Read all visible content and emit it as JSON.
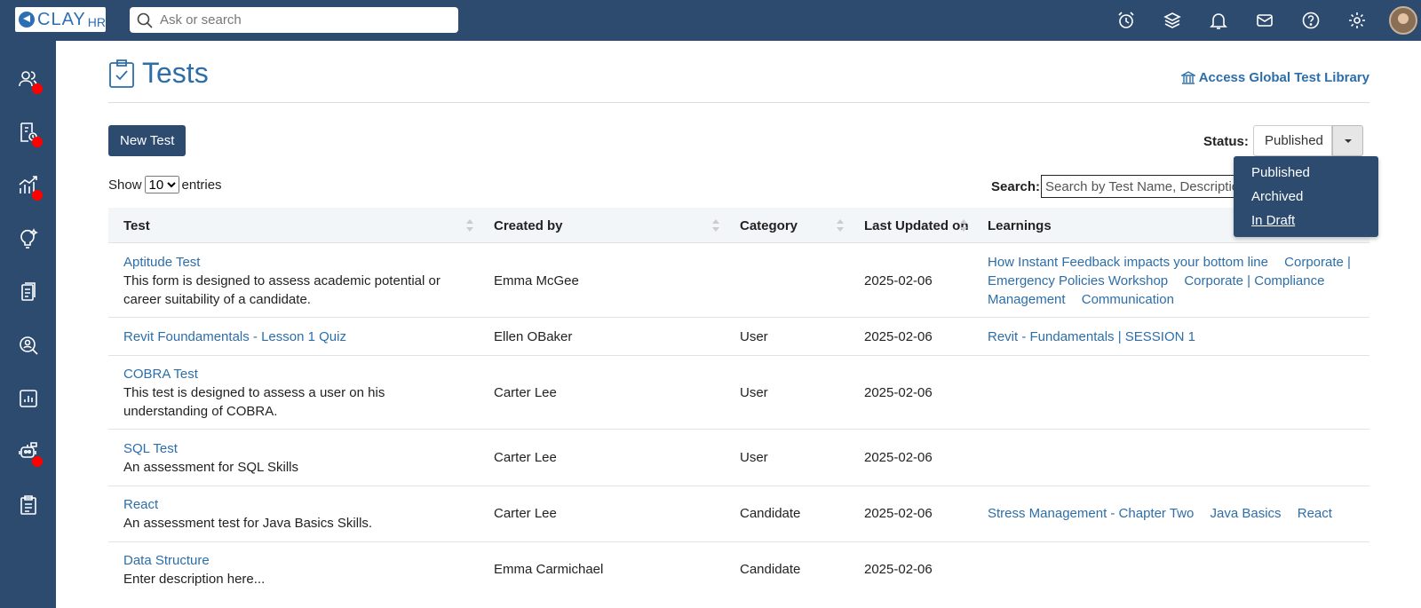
{
  "app": {
    "logo_text": "CLAY",
    "logo_sub": "HR"
  },
  "topbar": {
    "search_placeholder": "Ask or search",
    "icons": [
      "alarm-clock-icon",
      "layers-icon",
      "bell-icon",
      "mail-icon",
      "help-icon",
      "gear-icon"
    ]
  },
  "sidebar": {
    "items": [
      {
        "icon": "people-icon",
        "badge": true
      },
      {
        "icon": "payroll-icon",
        "badge": true
      },
      {
        "icon": "chart-growth-icon",
        "badge": true
      },
      {
        "icon": "lightbulb-icon",
        "badge": false
      },
      {
        "icon": "documents-icon",
        "badge": false
      },
      {
        "icon": "person-search-icon",
        "badge": false
      },
      {
        "icon": "report-icon",
        "badge": false
      },
      {
        "icon": "bot-icon",
        "badge": true
      },
      {
        "icon": "clipboard-list-icon",
        "badge": false
      }
    ]
  },
  "page": {
    "title": "Tests",
    "global_link": "Access Global Test Library",
    "new_button": "New Test",
    "status_label": "Status:",
    "status_value": "Published",
    "show_prefix": "Show",
    "show_value": "10",
    "show_suffix": "entries",
    "search_label": "Search:",
    "search_placeholder": "Search by Test Name, Description or Tag"
  },
  "status_options": [
    "Published",
    "Archived",
    "In Draft"
  ],
  "table": {
    "headers": [
      "Test",
      "Created by",
      "Category",
      "Last Updated on",
      "Learnings"
    ],
    "rows": [
      {
        "name": "Aptitude Test",
        "description": "This form is designed to assess academic potential or career suitability of a candidate.",
        "created_by": "Emma McGee",
        "category": "",
        "updated": "2025-02-06",
        "learnings": [
          "How Instant Feedback impacts your bottom line",
          "Corporate | Emergency Policies Workshop",
          "Corporate | Compliance Management",
          "Communication"
        ]
      },
      {
        "name": "Revit Foundamentals - Lesson 1 Quiz",
        "description": "",
        "created_by": "Ellen OBaker",
        "category": "User",
        "updated": "2025-02-06",
        "learnings": [
          "Revit - Fundamentals | SESSION 1"
        ]
      },
      {
        "name": "COBRA Test",
        "description": "This test is designed to assess a user on his understanding of COBRA.",
        "created_by": "Carter Lee",
        "category": "User",
        "updated": "2025-02-06",
        "learnings": []
      },
      {
        "name": "SQL Test",
        "description": "An assessment for SQL Skills",
        "created_by": "Carter Lee",
        "category": "User",
        "updated": "2025-02-06",
        "learnings": []
      },
      {
        "name": "React",
        "description": "An assessment test for Java Basics Skills.",
        "created_by": "Carter Lee",
        "category": "Candidate",
        "updated": "2025-02-06",
        "learnings": [
          "Stress Management - Chapter Two",
          "Java Basics",
          "React"
        ]
      },
      {
        "name": "Data Structure",
        "description": "Enter description here...",
        "created_by": "Emma Carmichael",
        "category": "Candidate",
        "updated": "2025-02-06",
        "learnings": []
      }
    ]
  }
}
